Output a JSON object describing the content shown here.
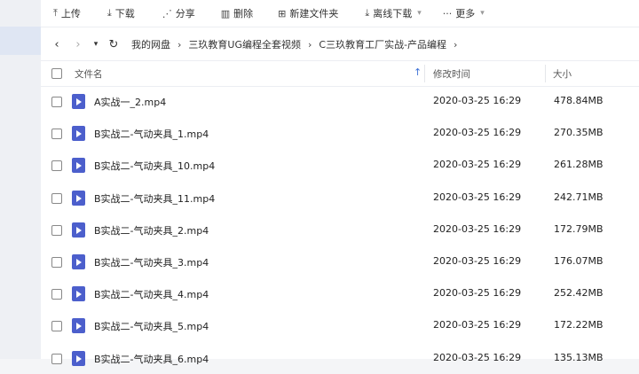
{
  "toolbar": {
    "upload": {
      "icon": "upload-icon",
      "label": "上传"
    },
    "download": {
      "icon": "download-icon",
      "label": "下载"
    },
    "share": {
      "icon": "share-icon",
      "label": "分享"
    },
    "delete": {
      "icon": "trash-icon",
      "label": "删除"
    },
    "new_folder": {
      "icon": "new-folder-icon",
      "label": "新建文件夹"
    },
    "offline_download": {
      "icon": "offline-download-icon",
      "label": "离线下载"
    },
    "more": {
      "icon": "more-icon",
      "label": "更多"
    }
  },
  "breadcrumbs": [
    "我的网盘",
    "三玖教育UG编程全套视频",
    "C三玖教育工厂实战-产品编程"
  ],
  "table": {
    "col_name": "文件名",
    "col_modified": "修改时间",
    "col_size": "大小",
    "sort_indicator": "↑",
    "rows": [
      {
        "name": "A实战一_2.mp4",
        "modified": "2020-03-25 16:29",
        "size": "478.84MB"
      },
      {
        "name": "B实战二-气动夹具_1.mp4",
        "modified": "2020-03-25 16:29",
        "size": "270.35MB"
      },
      {
        "name": "B实战二-气动夹具_10.mp4",
        "modified": "2020-03-25 16:29",
        "size": "261.28MB"
      },
      {
        "name": "B实战二-气动夹具_11.mp4",
        "modified": "2020-03-25 16:29",
        "size": "242.71MB"
      },
      {
        "name": "B实战二-气动夹具_2.mp4",
        "modified": "2020-03-25 16:29",
        "size": "172.79MB"
      },
      {
        "name": "B实战二-气动夹具_3.mp4",
        "modified": "2020-03-25 16:29",
        "size": "176.07MB"
      },
      {
        "name": "B实战二-气动夹具_4.mp4",
        "modified": "2020-03-25 16:29",
        "size": "252.42MB"
      },
      {
        "name": "B实战二-气动夹具_5.mp4",
        "modified": "2020-03-25 16:29",
        "size": "172.22MB"
      },
      {
        "name": "B实战二-气动夹具_6.mp4",
        "modified": "2020-03-25 16:29",
        "size": "135.13MB"
      }
    ]
  },
  "colors": {
    "accent": "#3b6fd6",
    "file_icon": "#4c5fcc"
  }
}
